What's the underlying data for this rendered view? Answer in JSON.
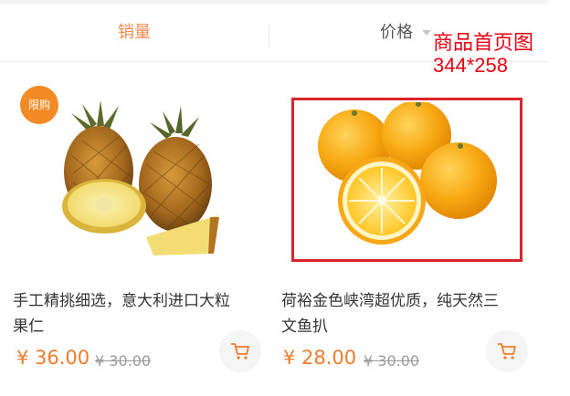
{
  "sort_bar": {
    "sales_label": "销量",
    "price_label": "价格",
    "active_tab": "销量"
  },
  "annotation": {
    "line1": "商品首页图",
    "line2": "344*258"
  },
  "products": [
    {
      "badge": "限购",
      "name": "手工精挑细选，意大利进口大粒果仁",
      "price": "¥ 36.00",
      "original_price": "¥ 30.00",
      "image": "pineapple"
    },
    {
      "badge": "",
      "name": "荷裕金色峡湾超优质，纯天然三文鱼扒",
      "price": "¥ 28.00",
      "original_price": "¥ 30.00",
      "image": "oranges"
    }
  ],
  "colors": {
    "accent": "#f07b2b",
    "badge": "#f28a26",
    "annotation": "#e60012"
  },
  "icons": {
    "cart": "shopping-cart-icon"
  }
}
